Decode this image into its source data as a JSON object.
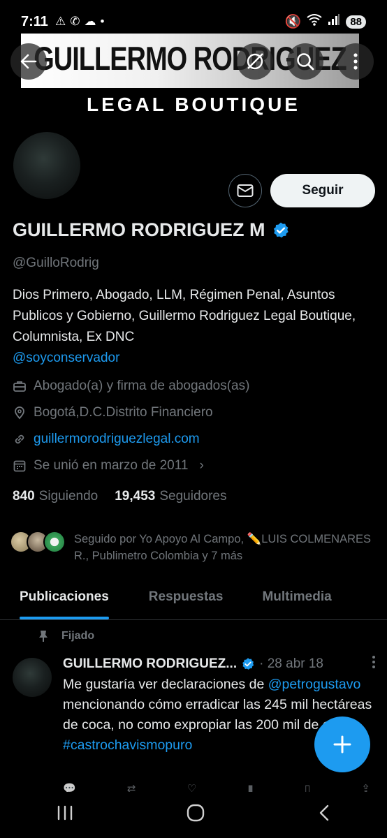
{
  "status_bar": {
    "time": "7:11",
    "battery": "88"
  },
  "banner": {
    "title": "GUILLERMO RODRIGUEZ",
    "subtitle": "LEGAL BOUTIQUE"
  },
  "profile": {
    "name": "GUILLERMO RODRIGUEZ M",
    "handle": "@GuilloRodrig",
    "follow_label": "Seguir",
    "bio_text": "Dios Primero, Abogado, LLM, Régimen Penal, Asuntos Publicos y Gobierno, Guillermo Rodriguez Legal Boutique, Columnista, Ex DNC",
    "bio_mention": "@soyconservador",
    "category": "Abogado(a) y firma de abogados(as)",
    "location": "Bogotá,D.C.Distrito Financiero",
    "website": "guillermorodriguezlegal.com",
    "joined": "Se unió en marzo de 2011",
    "following_count": "840",
    "following_label": "Siguiendo",
    "followers_count": "19,453",
    "followers_label": "Seguidores",
    "followed_by": "Seguido por Yo Apoyo Al Campo, ✏️LUIS COLMENARES R., Publimetro Colombia y 7 más"
  },
  "tabs": [
    "Publicaciones",
    "Respuestas",
    "Multimedia"
  ],
  "post": {
    "pinned_label": "Fijado",
    "author": "GUILLERMO RODRIGUEZ...",
    "date": "· 28 abr 18",
    "text_before": "Me gustaría ver declaraciones de ",
    "mention": "@petrogustavo",
    "text_after": " mencionando cómo erradicar las 245 mil hectáreas de coca, no como expropiar las 200 mil de caña.",
    "hashtag": "#castrochavismopuro"
  },
  "colors": {
    "accent": "#1d9bf0",
    "background": "#000000",
    "muted": "#71767b"
  }
}
